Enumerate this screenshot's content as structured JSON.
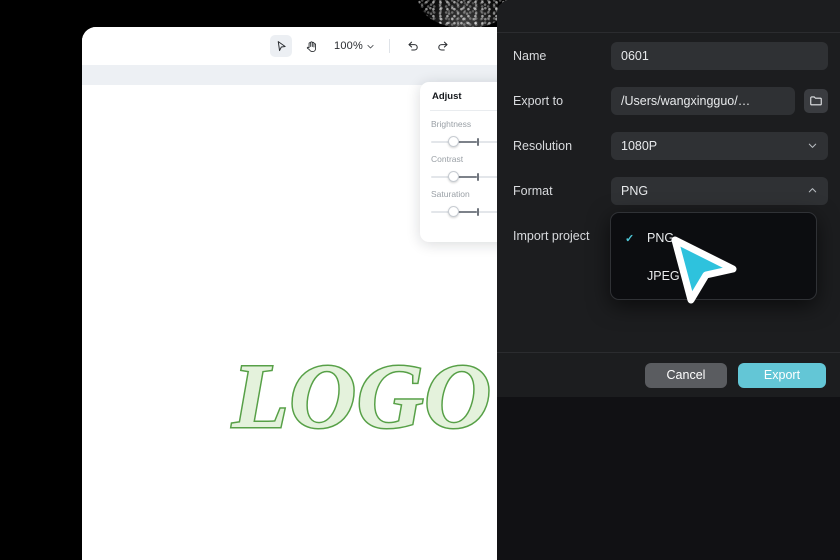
{
  "editor": {
    "toolbar": {
      "select_tool": "select-arrow",
      "hand_tool": "hand",
      "zoom_level": "100%",
      "zoom_caret": "⌄",
      "undo": "undo",
      "redo": "redo"
    },
    "canvas": {
      "logo_text": "LOGO",
      "logo_stroke_color": "#57a047",
      "logo_fill_color": "#e4f2dc"
    },
    "adjust_panel": {
      "title": "Adjust",
      "sliders": [
        {
          "label": "Brightness",
          "value": 25
        },
        {
          "label": "Contrast",
          "value": 25
        },
        {
          "label": "Saturation",
          "value": 25
        }
      ]
    }
  },
  "export_dialog": {
    "fields": {
      "name_label": "Name",
      "name_value": "0601",
      "export_to_label": "Export to",
      "export_to_value": "/Users/wangxingguo/…",
      "folder_icon": "folder-icon",
      "resolution_label": "Resolution",
      "resolution_value": "1080P",
      "resolution_caret": "⌄",
      "format_label": "Format",
      "format_value": "PNG",
      "format_caret": "⌃",
      "import_project_label": "Import project"
    },
    "format_menu": {
      "options": [
        {
          "label": "PNG",
          "checked": true,
          "check_glyph": "✓"
        },
        {
          "label": "JPEG",
          "checked": false,
          "check_glyph": ""
        }
      ]
    },
    "footer": {
      "cancel_label": "Cancel",
      "export_label": "Export"
    },
    "colors": {
      "accent": "#63c6d6",
      "cancel": "#5a5c60",
      "dialog_bg": "#1c1d1f",
      "field_bg": "#2f3134",
      "menu_bg": "#0c0d10"
    }
  },
  "cursor": {
    "name": "pointer-arrow",
    "fill": "#2ec2dd",
    "stroke": "#ffffff"
  }
}
